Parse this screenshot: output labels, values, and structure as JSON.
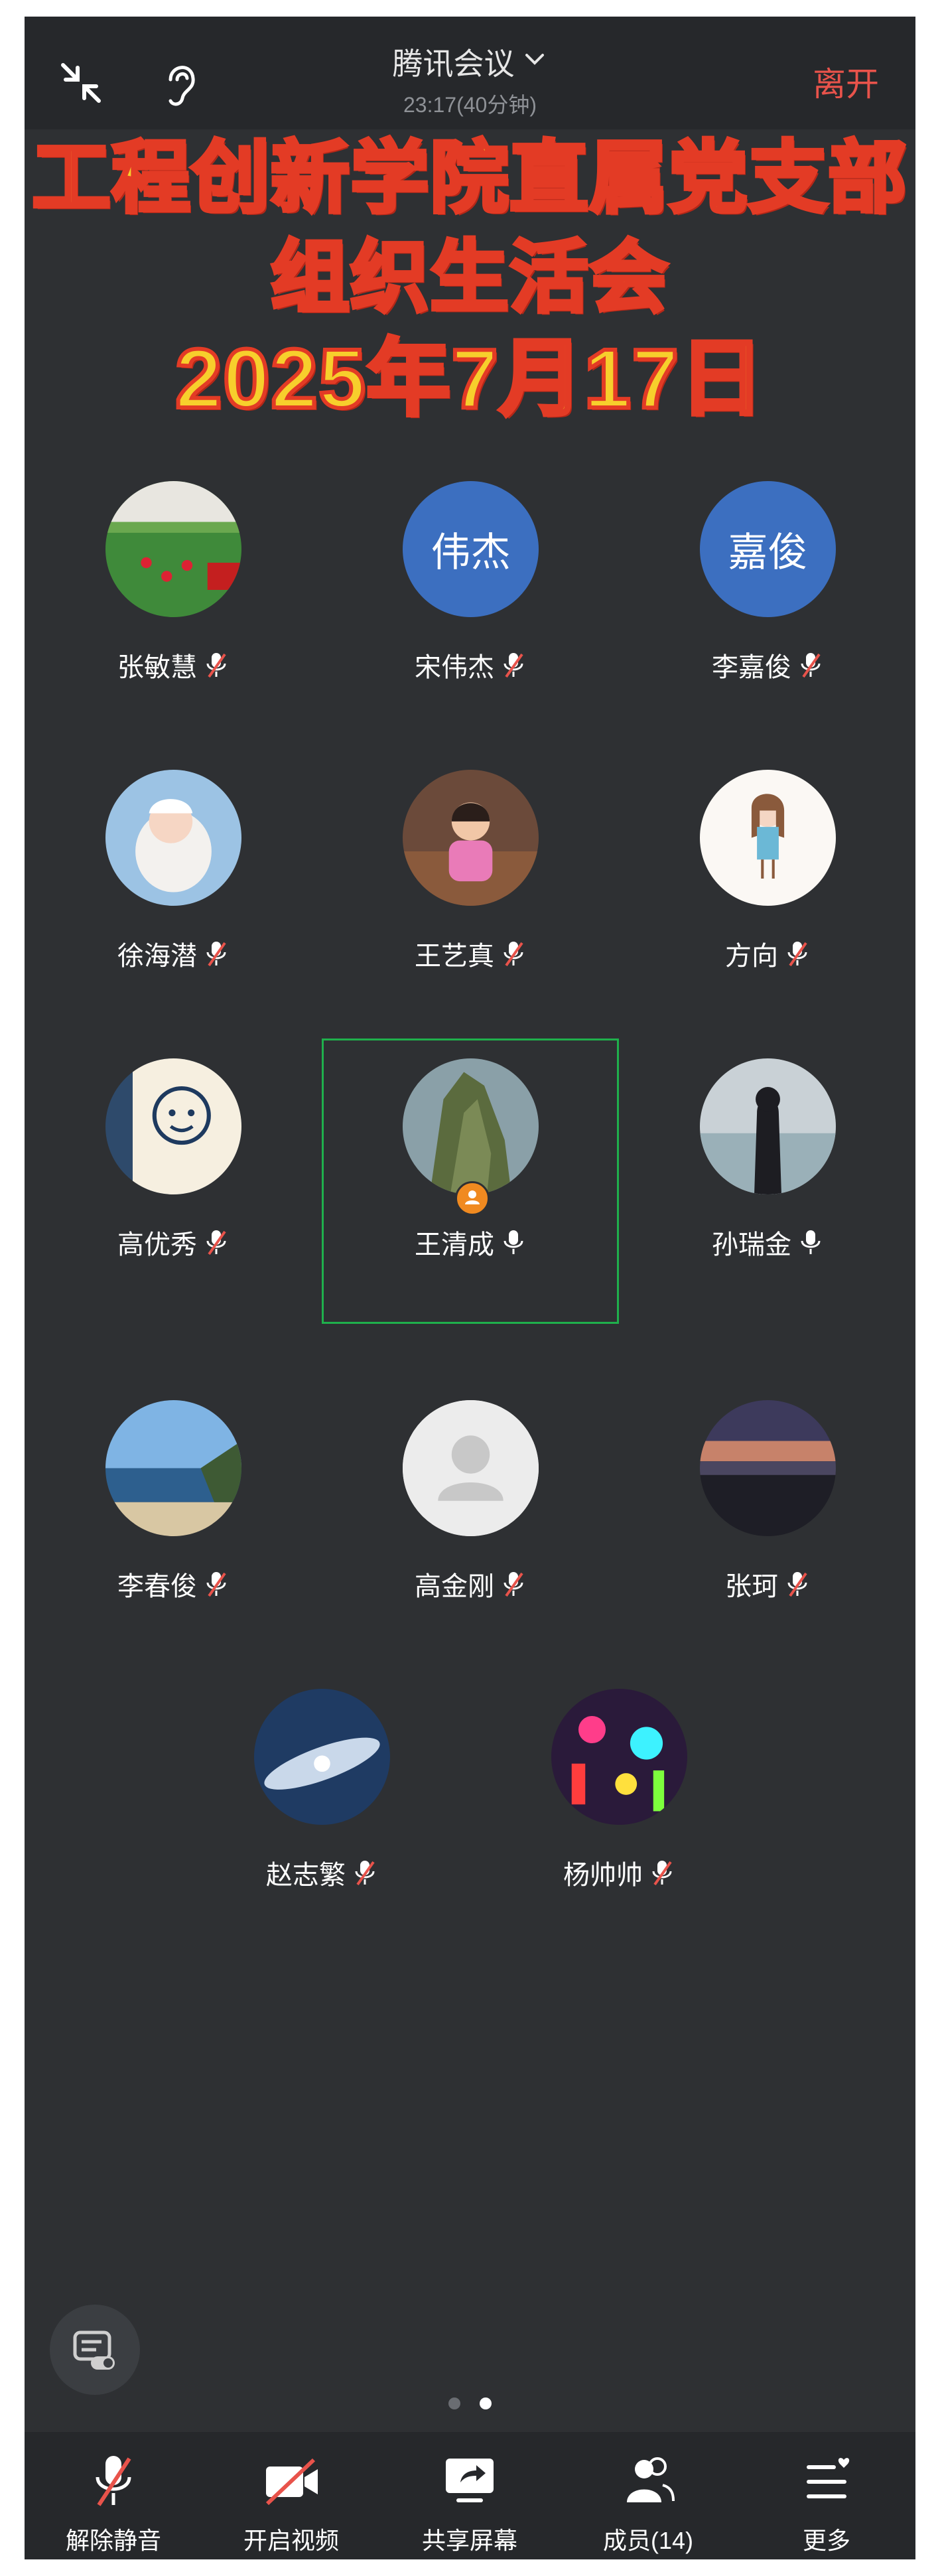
{
  "header": {
    "title": "腾讯会议",
    "duration": "23:17(40分钟)",
    "leave_label": "离开"
  },
  "banner": {
    "line1": "工程创新学院直属党支部",
    "line2": "组织生活会",
    "line3": "2025年7月17日"
  },
  "participants": [
    {
      "name": "张敏慧",
      "avatar": "photo-field",
      "mic": "muted"
    },
    {
      "name": "宋伟杰",
      "avatar_text": "伟杰",
      "mic": "muted"
    },
    {
      "name": "李嘉俊",
      "avatar_text": "嘉俊",
      "mic": "muted"
    },
    {
      "name": "徐海潜",
      "avatar": "photo-baby",
      "mic": "muted"
    },
    {
      "name": "王艺真",
      "avatar": "photo-child",
      "mic": "muted"
    },
    {
      "name": "方向",
      "avatar": "photo-cartoon-girl",
      "mic": "muted"
    },
    {
      "name": "高优秀",
      "avatar": "photo-cartoon-face",
      "mic": "muted"
    },
    {
      "name": "王清成",
      "avatar": "photo-mountain",
      "mic": "on",
      "host": true,
      "active": true
    },
    {
      "name": "孙瑞金",
      "avatar": "photo-woman-river",
      "mic": "on"
    },
    {
      "name": "李春俊",
      "avatar": "photo-seaside",
      "mic": "muted"
    },
    {
      "name": "高金刚",
      "avatar": "default-avatar",
      "mic": "muted"
    },
    {
      "name": "张珂",
      "avatar": "photo-sunset",
      "mic": "muted"
    },
    {
      "name": "赵志繁",
      "avatar": "photo-galaxy",
      "mic": "muted"
    },
    {
      "name": "杨帅帅",
      "avatar": "photo-neon",
      "mic": "muted"
    }
  ],
  "toolbar": {
    "unmute_label": "解除静音",
    "video_label": "开启视频",
    "share_label": "共享屏幕",
    "members_label": "成员(14)",
    "more_label": "更多"
  },
  "pagination": {
    "pages": 2,
    "current": 2
  },
  "colors": {
    "background": "#2e3033",
    "bar": "#26282b",
    "leave": "#e8534b",
    "muted_slash": "#e8534b",
    "active_border": "#1fb04c",
    "avatar_blue": "#3c6fc0",
    "banner_fill": "#f7cf2c",
    "banner_stroke": "#e33b25"
  }
}
